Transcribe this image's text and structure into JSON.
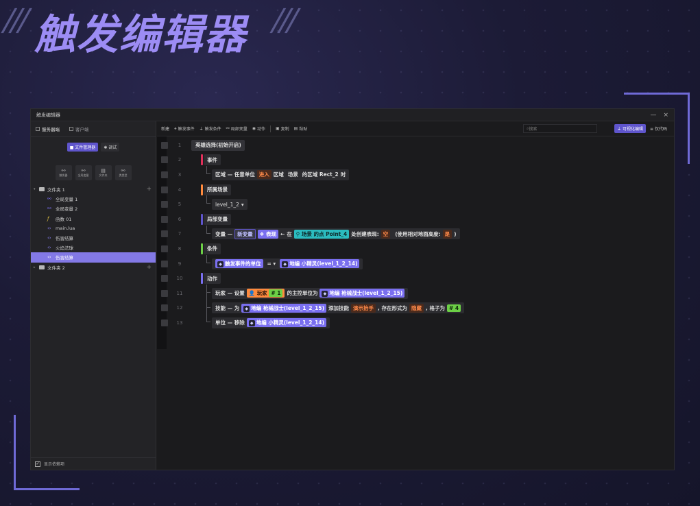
{
  "hero": {
    "title": "触发编辑器"
  },
  "window": {
    "title": "触发编辑器",
    "controls": {
      "minimize": "—",
      "close": "×"
    }
  },
  "sidebar": {
    "tabs": [
      {
        "label": "服务器端"
      },
      {
        "label": "客户端"
      }
    ],
    "modes": [
      {
        "label": "文件管理器"
      },
      {
        "label": "调试"
      }
    ],
    "tools": [
      {
        "label": "触发器"
      },
      {
        "label": "全局变量"
      },
      {
        "label": "文件夹"
      },
      {
        "label": "类类型"
      }
    ],
    "tree": [
      {
        "label": "文件夹 1",
        "type": "folder"
      },
      {
        "label": "全局变量 1",
        "type": "var"
      },
      {
        "label": "全局变量 2",
        "type": "var"
      },
      {
        "label": "函数 01",
        "type": "func"
      },
      {
        "label": "main.lua",
        "type": "code"
      },
      {
        "label": "伤害结算",
        "type": "code"
      },
      {
        "label": "火焰法球",
        "type": "code"
      },
      {
        "label": "伤害结算",
        "type": "code"
      },
      {
        "label": "文件夹 2",
        "type": "folder"
      }
    ],
    "footer": "显示依赖项"
  },
  "toolbar": {
    "new_label": "新建",
    "items": [
      "触发事件",
      "触发条件",
      "局部变量",
      "动作"
    ],
    "copy": "复制",
    "paste": "粘贴",
    "search_placeholder": "搜索",
    "view_visual": "可视化编辑",
    "view_code": "仅代码"
  },
  "editor": {
    "lines": [
      "1",
      "2",
      "3",
      "4",
      "5",
      "6",
      "7",
      "8",
      "9",
      "10",
      "11",
      "12",
      "13"
    ],
    "l1": "英雄选择(初始开启)",
    "l2": "事件",
    "l3": {
      "a": "区域 — 任意单位",
      "b": "进入",
      "c": "区域",
      "d": "场景",
      "e": "的区域 Rect_2",
      "f": "时"
    },
    "l4": "所属场景",
    "l5": {
      "value": "level_1_2",
      "arrow": "▾"
    },
    "l6": "局部变量",
    "l7": {
      "a": "变量 —",
      "b": "新变量",
      "c": "表现",
      "arrow": "←",
      "d": "在",
      "e": "场景",
      "f": "的点 Point_4",
      "g": "处创建表现:",
      "h": "空",
      "i": "(使用相对地面高度:",
      "j": "是",
      "k": ")"
    },
    "l8": "条件",
    "l9": {
      "a": "触发事件的单位",
      "op": "=",
      "b": "地编 小精灵(level_1_2_14)"
    },
    "l10": "动作",
    "l11": {
      "a": "玩家 — 设置",
      "b": "玩家",
      "hash": "#",
      "num": "1",
      "c": "的主控单位为",
      "d": "地编 枪械战士(level_1_2_15)"
    },
    "l12": {
      "a": "技能 — 为",
      "b": "地编 枪械战士(level_1_2_15)",
      "c": "添加技能",
      "d": "演示抬手",
      "e": ", 存在形式为",
      "f": "隐藏",
      "g": ", 格子为",
      "hash": "#",
      "num": "4"
    },
    "l13": {
      "a": "单位 — 移除",
      "b": "地编 小精灵(level_1_2_14)"
    }
  },
  "colors": {
    "accent": "#5f55cc",
    "event_bar": "#e0305a",
    "scene_bar": "#ff8a3d",
    "var_bar": "#5f55cc",
    "cond_bar": "#6ccf46",
    "action_bar": "#7a6ff0"
  }
}
